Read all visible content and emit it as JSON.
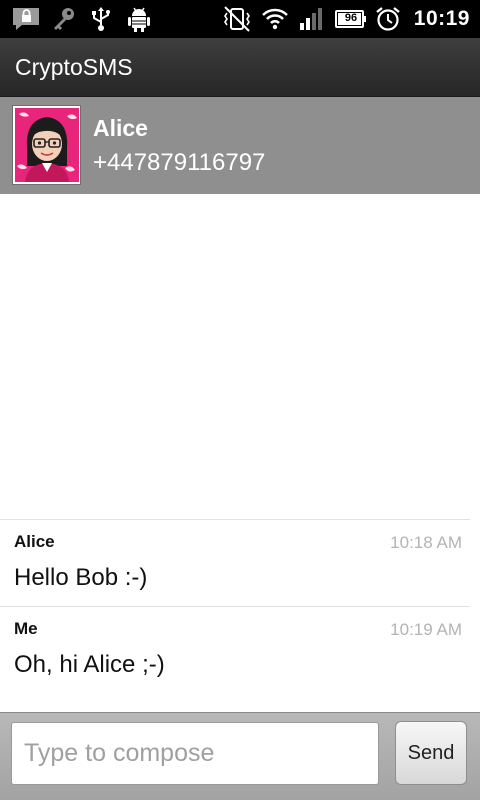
{
  "status_bar": {
    "time": "10:19",
    "battery_level": "96",
    "icons": [
      "sms-lock-icon",
      "key-icon",
      "usb-icon",
      "android-debug-icon",
      "silent-vibrate-icon",
      "wifi-icon",
      "signal-icon",
      "battery-icon",
      "alarm-icon"
    ]
  },
  "app": {
    "title": "CryptoSMS"
  },
  "contact": {
    "name": "Alice",
    "number": "+447879116797"
  },
  "messages": [
    {
      "sender": "Alice",
      "time": "10:18 AM",
      "body": "Hello Bob :-)"
    },
    {
      "sender": "Me",
      "time": "10:19 AM",
      "body": "Oh, hi Alice ;-)"
    }
  ],
  "compose": {
    "placeholder": "Type to compose",
    "value": "",
    "send_label": "Send"
  }
}
